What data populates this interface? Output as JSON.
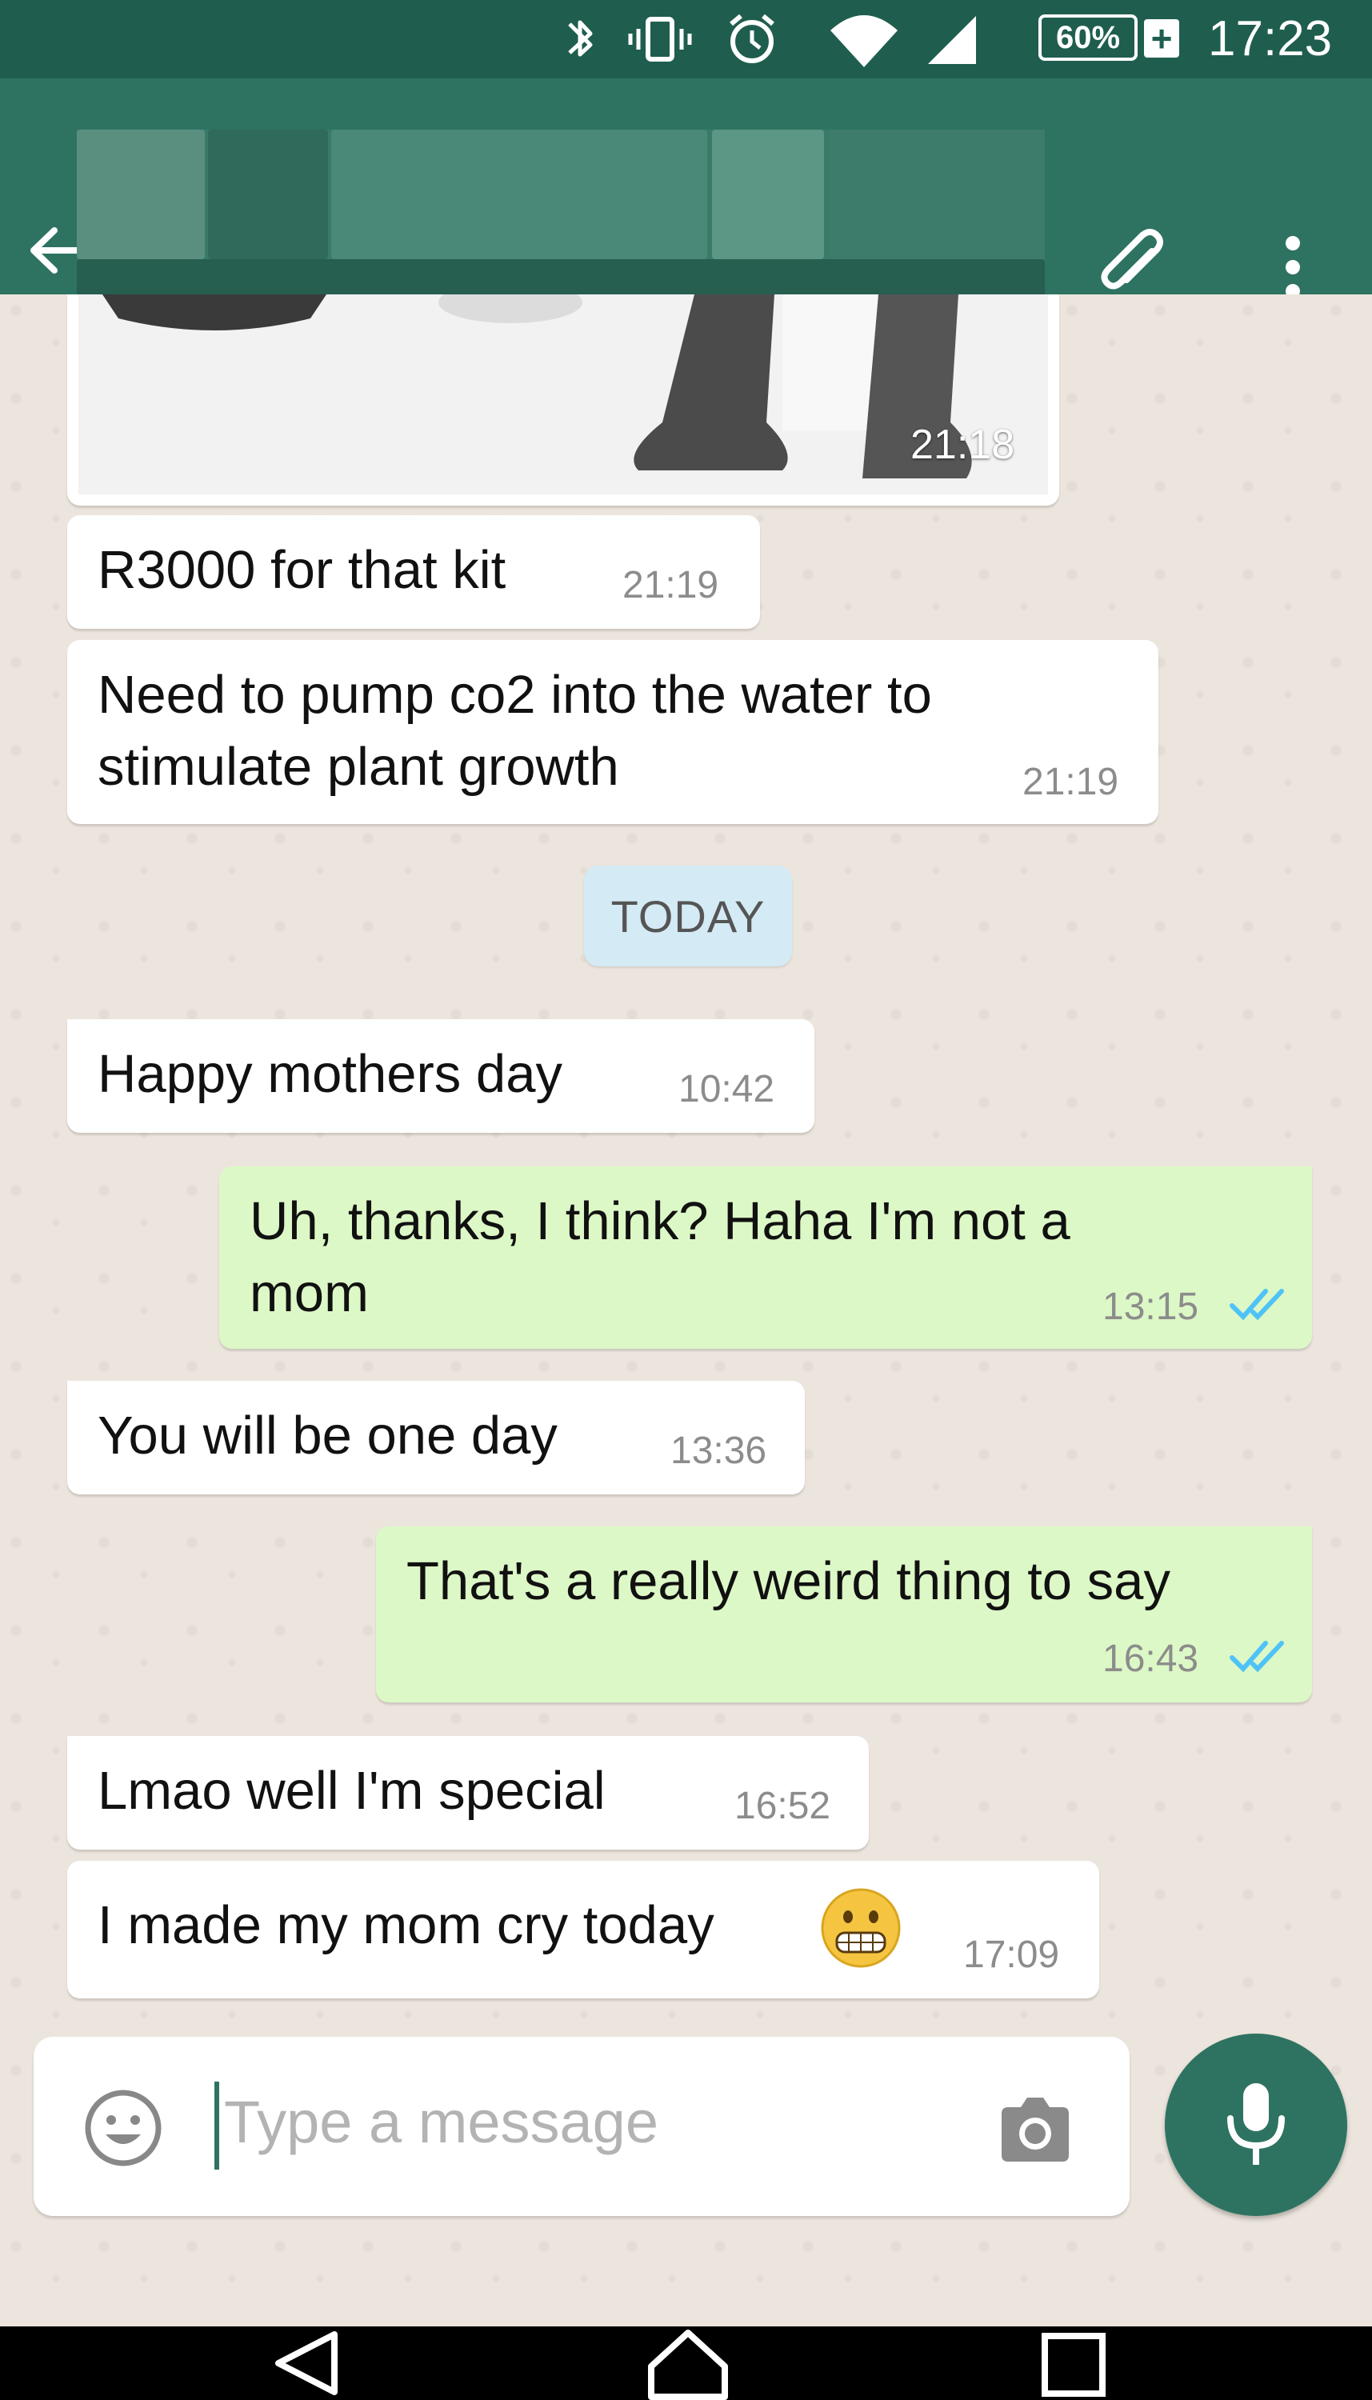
{
  "status_bar": {
    "battery": "60%",
    "battery_plus": "+",
    "time": "17:23"
  },
  "header": {
    "contact_name": ""
  },
  "messages": [
    {
      "text": "R3000 for that kit",
      "time": "21:19"
    },
    {
      "text": "Need to pump co2 into the water to\nstimulate plant growth",
      "time": "21:19"
    },
    {
      "text": "Happy mothers day",
      "time": "10:42"
    },
    {
      "text": "Uh, thanks, I think? Haha I'm not a\nmom",
      "time": "13:15"
    },
    {
      "text": "You will be one day",
      "time": "13:36"
    },
    {
      "text": "That's a really weird thing to say",
      "time": "16:43"
    },
    {
      "text": "Lmao well I'm special",
      "time": "16:52"
    },
    {
      "text": "I made my mom cry today",
      "time": "17:09"
    }
  ],
  "image_message": {
    "time": "21:18"
  },
  "date_divider": "TODAY",
  "composer": {
    "placeholder": "Type a message"
  },
  "icons": {
    "back": "arrow-left-icon",
    "attach": "paperclip-icon",
    "menu": "more-vertical-icon",
    "emoji": "smiley-icon",
    "camera": "camera-icon",
    "mic": "mic-icon",
    "grimace_emoji": "grimacing-face-icon"
  },
  "colors": {
    "header": "#2e7362",
    "status_bar": "#1f5e4f",
    "outgoing_bubble": "#dcf8c6",
    "incoming_bubble": "#ffffff",
    "read_ticks": "#4fc3f7"
  }
}
